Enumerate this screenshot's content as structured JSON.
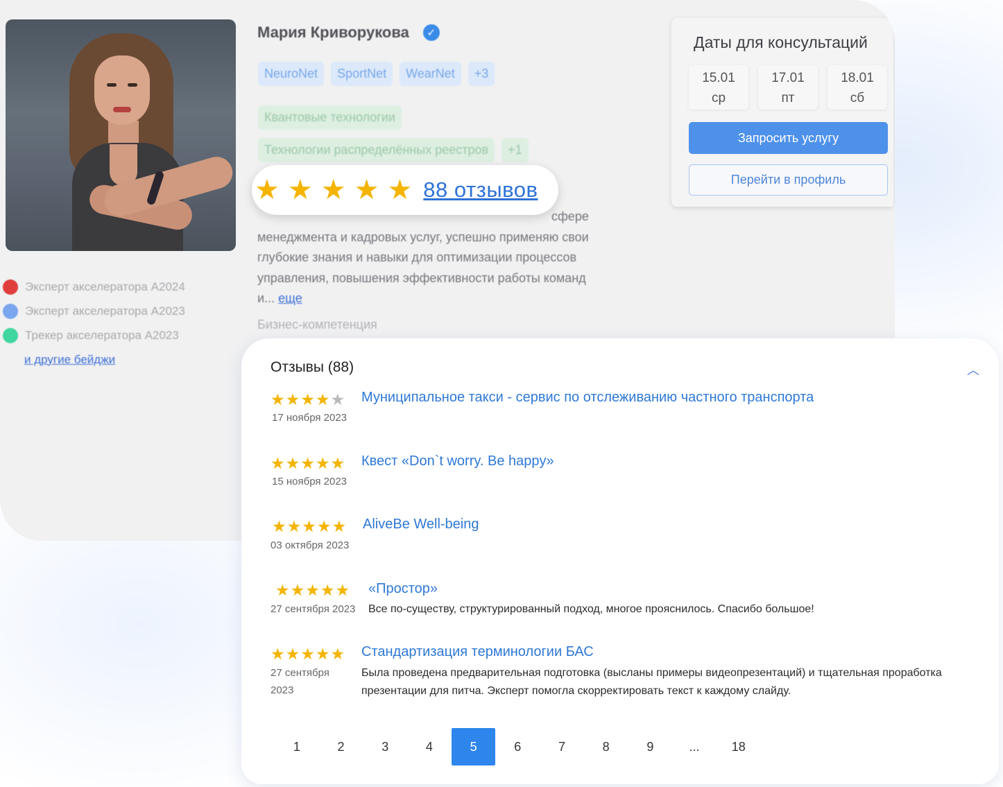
{
  "expert": {
    "name": "Мария Криворукова",
    "tags_blue": [
      "NeuroNet",
      "SportNet",
      "WearNet",
      "+3"
    ],
    "tags_green_row1": [
      "Квантовые технологии"
    ],
    "tags_green_row2": [
      "Технологии распределённых реестров",
      "+1"
    ],
    "badges": [
      {
        "label": "Эксперт акселератора А2024",
        "color": "#e03d3d"
      },
      {
        "label": "Эксперт акселератора А2023",
        "color": "#7aa6ee"
      },
      {
        "label": "Трекер акселератора А2023",
        "color": "#3fd6a0"
      }
    ],
    "more_badges": "и другие бейджи",
    "description_lines": [
      "менеджмента и кадровых услуг, успешно применяю свои",
      "глубокие знания и навыки для оптимизации процессов",
      "управления, повышения эффективности работы команд"
    ],
    "description_partial_first": "сфере",
    "description_tail": "и...",
    "description_more": "еще",
    "competence": "Бизнес-компетенция"
  },
  "rating": {
    "stars": 5,
    "reviews_link": "88 отзывов"
  },
  "dates_card": {
    "title": "Даты для консультаций",
    "dates": [
      {
        "date": "15.01",
        "day": "ср"
      },
      {
        "date": "17.01",
        "day": "пт"
      },
      {
        "date": "18.01",
        "day": "сб"
      }
    ],
    "request_button": "Запросить услугу",
    "profile_button": "Перейти в профиль"
  },
  "reviews": {
    "title": "Отзывы (88)",
    "chevron": "^",
    "items": [
      {
        "rating": 4,
        "title": "Муниципальное такси - сервис по отслеживанию частного транспорта",
        "date": "17 ноября 2023",
        "text": ""
      },
      {
        "rating": 5,
        "title": "Квест «Don`t worry. Be happy»",
        "date": "15 ноября 2023",
        "text": ""
      },
      {
        "rating": 5,
        "title": "AliveBe Well-being",
        "date": "03 октября 2023",
        "text": ""
      },
      {
        "rating": 5,
        "title": "«Простор»",
        "date": "27 сентября 2023",
        "text": "Все по-существу, структурированный подход, многое прояснилось. Спасибо большое!"
      },
      {
        "rating": 5,
        "title": "Стандартизация терминологии БАС",
        "date_line1": "27 сентября",
        "date_line2": "2023",
        "text_line1": "Была проведена предварительная подготовка (высланы примеры видеопрезентаций) и тщательная проработка",
        "text_line2": "презентации для питча. Эксперт помогла скорректировать текст к каждому слайду."
      }
    ]
  },
  "pagination": {
    "pages": [
      "1",
      "2",
      "3",
      "4",
      "5",
      "6",
      "7",
      "8",
      "9",
      "...",
      "18"
    ],
    "current": "5"
  },
  "colors": {
    "star": "#f4b400",
    "star_empty": "#b9b9b9",
    "link": "#2e78d6",
    "accent": "#2e86ec"
  }
}
